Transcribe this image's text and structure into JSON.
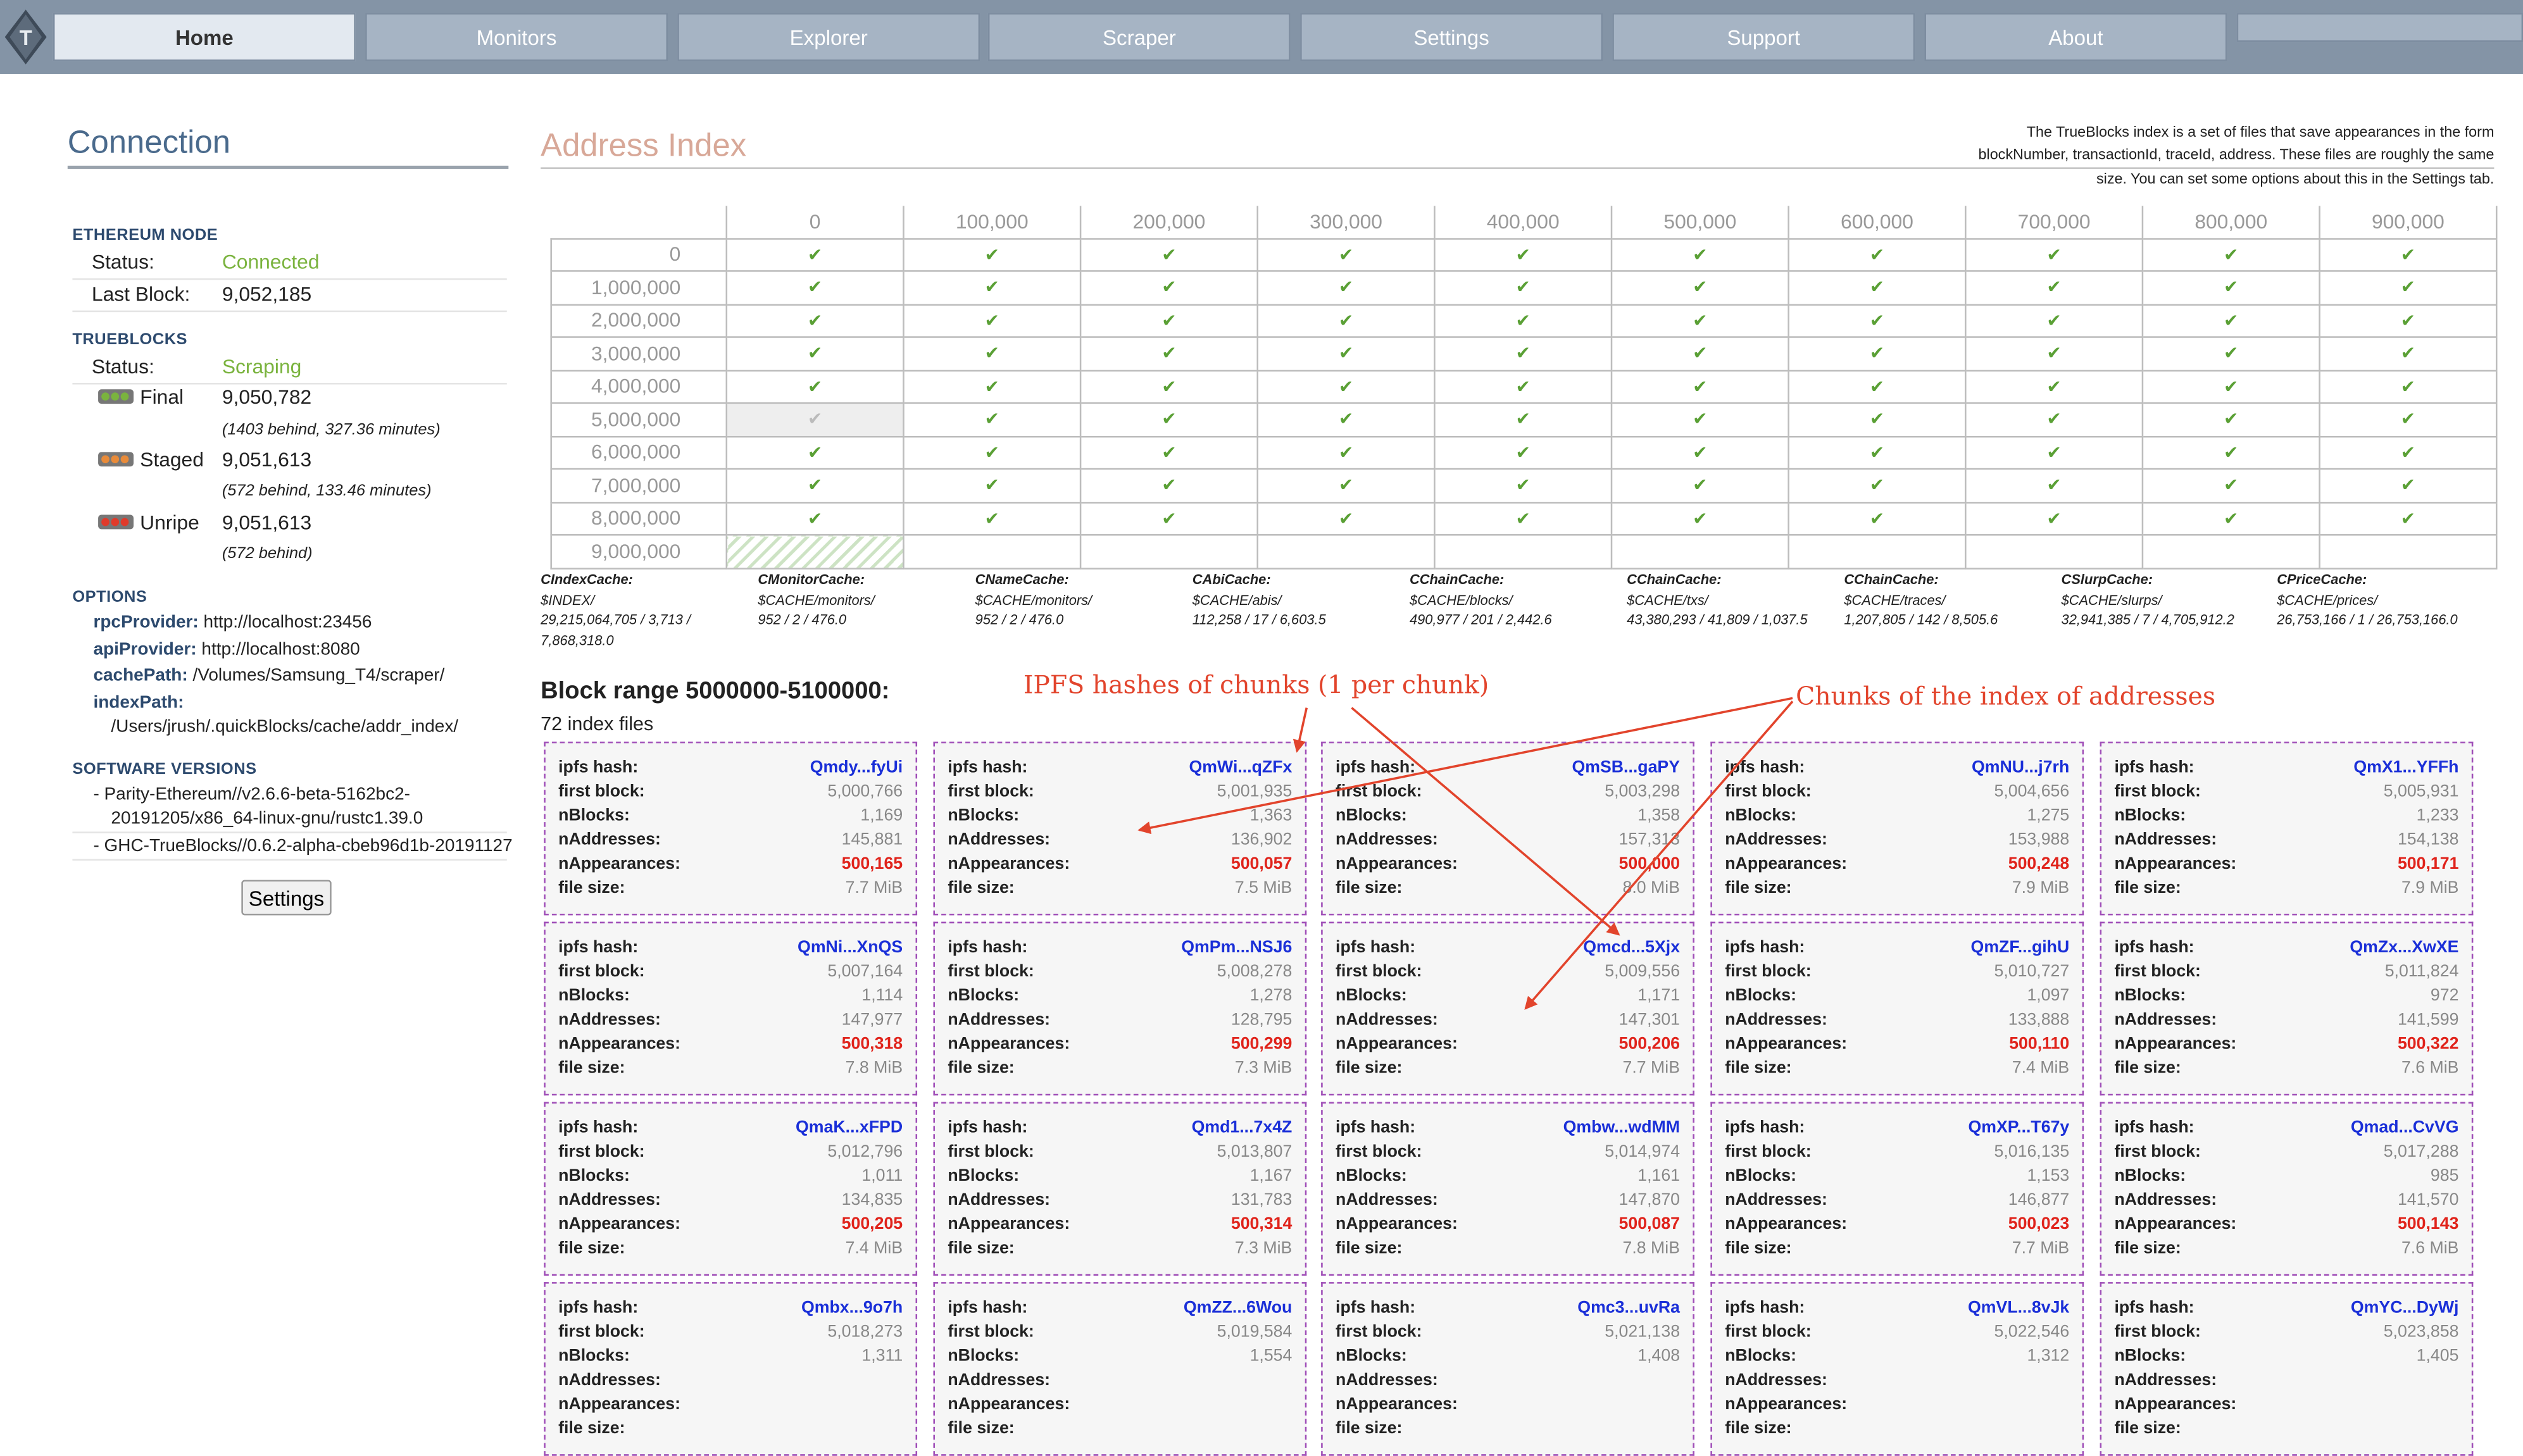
{
  "nav": {
    "tabs": [
      {
        "label": "Home",
        "active": true
      },
      {
        "label": "Monitors"
      },
      {
        "label": "Explorer"
      },
      {
        "label": "Scraper"
      },
      {
        "label": "Settings"
      },
      {
        "label": "Support"
      },
      {
        "label": "About"
      }
    ]
  },
  "connection": {
    "title": "Connection",
    "ethereum_node": {
      "heading": "ETHEREUM NODE",
      "status_label": "Status:",
      "status_value": "Connected",
      "last_block_label": "Last Block:",
      "last_block_value": "9,052,185"
    },
    "trueblocks": {
      "heading": "TRUEBLOCKS",
      "status_label": "Status:",
      "status_value": "Scraping",
      "final_label": "Final",
      "final_value": "9,050,782",
      "final_note": "(1403 behind, 327.36 minutes)",
      "staged_label": "Staged",
      "staged_value": "9,051,613",
      "staged_note": "(572 behind, 133.46 minutes)",
      "unripe_label": "Unripe",
      "unripe_value": "9,051,613",
      "unripe_note": "(572 behind)"
    },
    "options": {
      "heading": "OPTIONS",
      "rpc_label": "rpcProvider:",
      "rpc_value": "http://localhost:23456",
      "api_label": "apiProvider:",
      "api_value": "http://localhost:8080",
      "cache_label": "cachePath:",
      "cache_value": "/Volumes/Samsung_T4/scraper/",
      "index_label": "indexPath:",
      "index_value": "/Users/jrush/.quickBlocks/cache/addr_index/"
    },
    "software": {
      "heading": "SOFTWARE VERSIONS",
      "parity_1": "- Parity-Ethereum//v2.6.6-beta-5162bc2-",
      "parity_2": "20191205/x86_64-linux-gnu/rustc1.39.0",
      "trueblocks": "- GHC-TrueBlocks//0.6.2-alpha-cbeb96d1b-20191127"
    },
    "settings_button": "Settings"
  },
  "address_index": {
    "title": "Address Index",
    "note": "The TrueBlocks index is a set of files that save appearances in the form blockNumber, transactionId, traceId, address. These files are roughly the same size. You can set some options about this in the Settings tab.",
    "columns": [
      "0",
      "100,000",
      "200,000",
      "300,000",
      "400,000",
      "500,000",
      "600,000",
      "700,000",
      "800,000",
      "900,000"
    ],
    "rows": [
      "0",
      "1,000,000",
      "2,000,000",
      "3,000,000",
      "4,000,000",
      "5,000,000",
      "6,000,000",
      "7,000,000",
      "8,000,000",
      "9,000,000"
    ],
    "check": "✔",
    "caches": [
      {
        "name": "CIndexCache:",
        "path": "$INDEX/",
        "stats": "29,215,064,705 / 3,713 / 7,868,318.0"
      },
      {
        "name": "CMonitorCache:",
        "path": "$CACHE/monitors/",
        "stats": "952 / 2 / 476.0"
      },
      {
        "name": "CNameCache:",
        "path": "$CACHE/monitors/",
        "stats": "952 / 2 / 476.0"
      },
      {
        "name": "CAbiCache:",
        "path": "$CACHE/abis/",
        "stats": "112,258 / 17 / 6,603.5"
      },
      {
        "name": "CChainCache:",
        "path": "$CACHE/blocks/",
        "stats": "490,977 / 201 / 2,442.6"
      },
      {
        "name": "CChainCache:",
        "path": "$CACHE/txs/",
        "stats": "43,380,293 / 41,809 / 1,037.5"
      },
      {
        "name": "CChainCache:",
        "path": "$CACHE/traces/",
        "stats": "1,207,805 / 142 / 8,505.6"
      },
      {
        "name": "CSlurpCache:",
        "path": "$CACHE/slurps/",
        "stats": "32,941,385 / 7 / 4,705,912.2"
      },
      {
        "name": "CPriceCache:",
        "path": "$CACHE/prices/",
        "stats": "26,753,166 / 1 / 26,753,166.0"
      }
    ]
  },
  "block_range": {
    "title": "Block range 5000000-5100000:",
    "subtitle": "72 index files",
    "labels": {
      "hash": "ipfs hash:",
      "first": "first block:",
      "nblocks": "nBlocks:",
      "naddr": "nAddresses:",
      "napp": "nAppearances:",
      "size": "file size:"
    },
    "chunks": [
      {
        "hash": "Qmdy...fyUi",
        "first": "5,000,766",
        "nblocks": "1,169",
        "naddr": "145,881",
        "napp": "500,165",
        "size": "7.7 MiB"
      },
      {
        "hash": "QmWi...qZFx",
        "first": "5,001,935",
        "nblocks": "1,363",
        "naddr": "136,902",
        "napp": "500,057",
        "size": "7.5 MiB"
      },
      {
        "hash": "QmSB...gaPY",
        "first": "5,003,298",
        "nblocks": "1,358",
        "naddr": "157,313",
        "napp": "500,000",
        "size": "8.0 MiB"
      },
      {
        "hash": "QmNU...j7rh",
        "first": "5,004,656",
        "nblocks": "1,275",
        "naddr": "153,988",
        "napp": "500,248",
        "size": "7.9 MiB"
      },
      {
        "hash": "QmX1...YFFh",
        "first": "5,005,931",
        "nblocks": "1,233",
        "naddr": "154,138",
        "napp": "500,171",
        "size": "7.9 MiB"
      },
      {
        "hash": "QmNi...XnQS",
        "first": "5,007,164",
        "nblocks": "1,114",
        "naddr": "147,977",
        "napp": "500,318",
        "size": "7.8 MiB"
      },
      {
        "hash": "QmPm...NSJ6",
        "first": "5,008,278",
        "nblocks": "1,278",
        "naddr": "128,795",
        "napp": "500,299",
        "size": "7.3 MiB"
      },
      {
        "hash": "Qmcd...5Xjx",
        "first": "5,009,556",
        "nblocks": "1,171",
        "naddr": "147,301",
        "napp": "500,206",
        "size": "7.7 MiB"
      },
      {
        "hash": "QmZF...gihU",
        "first": "5,010,727",
        "nblocks": "1,097",
        "naddr": "133,888",
        "napp": "500,110",
        "size": "7.4 MiB"
      },
      {
        "hash": "QmZx...XwXE",
        "first": "5,011,824",
        "nblocks": "972",
        "naddr": "141,599",
        "napp": "500,322",
        "size": "7.6 MiB"
      },
      {
        "hash": "QmaK...xFPD",
        "first": "5,012,796",
        "nblocks": "1,011",
        "naddr": "134,835",
        "napp": "500,205",
        "size": "7.4 MiB"
      },
      {
        "hash": "Qmd1...7x4Z",
        "first": "5,013,807",
        "nblocks": "1,167",
        "naddr": "131,783",
        "napp": "500,314",
        "size": "7.3 MiB"
      },
      {
        "hash": "Qmbw...wdMM",
        "first": "5,014,974",
        "nblocks": "1,161",
        "naddr": "147,870",
        "napp": "500,087",
        "size": "7.8 MiB"
      },
      {
        "hash": "QmXP...T67y",
        "first": "5,016,135",
        "nblocks": "1,153",
        "naddr": "146,877",
        "napp": "500,023",
        "size": "7.7 MiB"
      },
      {
        "hash": "Qmad...CvVG",
        "first": "5,017,288",
        "nblocks": "985",
        "naddr": "141,570",
        "napp": "500,143",
        "size": "7.6 MiB"
      },
      {
        "hash": "Qmbx...9o7h",
        "first": "5,018,273",
        "nblocks": "1,311",
        "naddr": "",
        "napp": "",
        "size": ""
      },
      {
        "hash": "QmZZ...6Wou",
        "first": "5,019,584",
        "nblocks": "1,554",
        "naddr": "",
        "napp": "",
        "size": ""
      },
      {
        "hash": "Qmc3...uvRa",
        "first": "5,021,138",
        "nblocks": "1,408",
        "naddr": "",
        "napp": "",
        "size": ""
      },
      {
        "hash": "QmVL...8vJk",
        "first": "5,022,546",
        "nblocks": "1,312",
        "naddr": "",
        "napp": "",
        "size": ""
      },
      {
        "hash": "QmYC...DyWj",
        "first": "5,023,858",
        "nblocks": "1,405",
        "naddr": "",
        "napp": "",
        "size": ""
      }
    ]
  },
  "annotations": {
    "ipfs": "IPFS hashes of chunks (1 per chunk)",
    "chunks": "Chunks of the index of addresses"
  },
  "colors": {
    "nav_bg": "#8494a6",
    "connected": "#7ab33e",
    "hash_blue": "#1a2fd8",
    "appearances_red": "#e0231b",
    "annotation": "#e2442c",
    "card_border": "#a04fb8"
  }
}
